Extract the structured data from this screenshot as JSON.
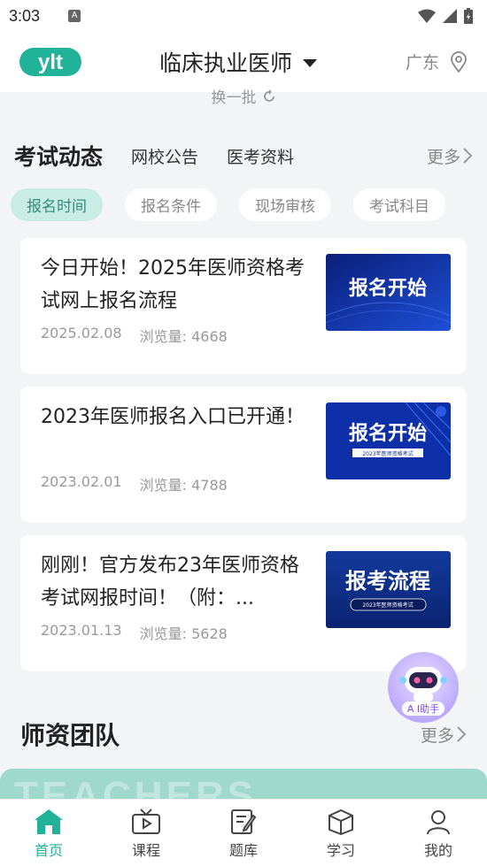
{
  "status_bar": {
    "time": "3:03",
    "notif_letter": "A"
  },
  "header": {
    "logo_text": "ylt",
    "title": "临床执业医师",
    "location": "广东"
  },
  "refresh_label": "换一批",
  "news_section": {
    "title": "考试动态",
    "tabs": [
      "网校公告",
      "医考资料"
    ],
    "more": "更多",
    "chips": [
      {
        "label": "报名时间",
        "active": true
      },
      {
        "label": "报名条件",
        "active": false
      },
      {
        "label": "现场审核",
        "active": false
      },
      {
        "label": "考试科目",
        "active": false
      }
    ],
    "articles": [
      {
        "title": "今日开始！2025年医师资格考试网上报名流程",
        "date": "2025.02.08",
        "views": "浏览量: 4668",
        "thumb_text": "报名开始",
        "thumb_sub": ""
      },
      {
        "title": "2023年医师报名入口已开通！",
        "date": "2023.02.01",
        "views": "浏览量: 4788",
        "thumb_text": "报名开始",
        "thumb_sub": "2023年医师资格考试"
      },
      {
        "title": "刚刚！官方发布23年医师资格考试网报时间！（附：...",
        "date": "2023.01.13",
        "views": "浏览量: 5628",
        "thumb_text": "报考流程",
        "thumb_sub": "2023年医师资格考试"
      }
    ]
  },
  "ai_assistant": {
    "label": "A I助手"
  },
  "team_section": {
    "title": "师资团队",
    "more": "更多",
    "banner_watermark": "TEACHERS"
  },
  "bottom_nav": [
    {
      "label": "首页",
      "icon": "home-icon",
      "active": true
    },
    {
      "label": "课程",
      "icon": "tv-icon",
      "active": false
    },
    {
      "label": "题库",
      "icon": "edit-note-icon",
      "active": false
    },
    {
      "label": "学习",
      "icon": "book-box-icon",
      "active": false
    },
    {
      "label": "我的",
      "icon": "person-icon",
      "active": false
    }
  ],
  "colors": {
    "accent": "#20b39a",
    "chip_active_bg": "#c9ece4",
    "thumb_blue": "#0d2fa8"
  }
}
